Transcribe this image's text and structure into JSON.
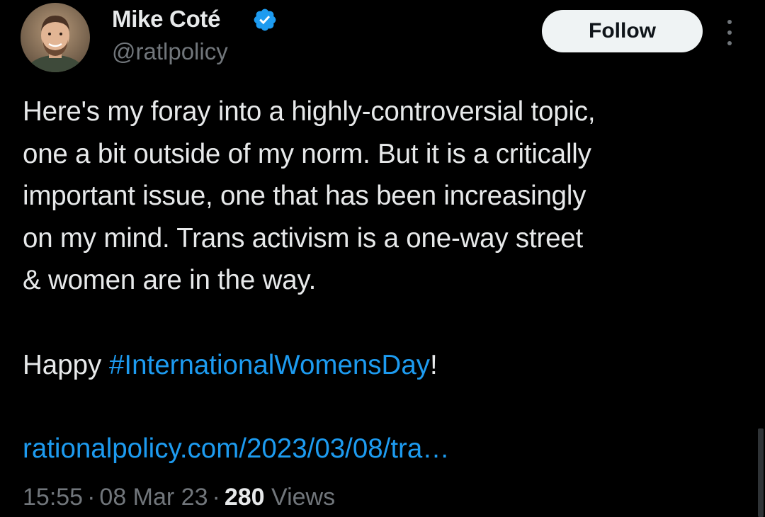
{
  "author": {
    "name": "Mike Coté",
    "handle": "@ratlpolicy",
    "verified": true,
    "avatar_icon": "profile-photo"
  },
  "actions": {
    "follow_label": "Follow",
    "more_icon": "more-vertical-icon"
  },
  "tweet": {
    "lines": [
      "Here's my foray into a highly-controversial topic,",
      "one a bit outside of my norm. But it is a critically",
      "important issue, one that has been increasingly",
      "on my mind. Trans activism is a one-way street",
      "& women are in the way."
    ],
    "greeting_prefix": "Happy ",
    "hashtag": "#InternationalWomensDay",
    "greeting_suffix": "!",
    "link_text": "rationalpolicy.com/2023/03/08/tra…"
  },
  "meta": {
    "time": "15:55",
    "date": "08 Mar 23",
    "separator": "·",
    "views_count": "280",
    "views_label": "Views"
  },
  "colors": {
    "background": "#000000",
    "text_primary": "#e7e9ea",
    "text_secondary": "#71767b",
    "link": "#1d9bf0",
    "verified": "#1d9bf0",
    "follow_bg": "#eff3f4"
  }
}
